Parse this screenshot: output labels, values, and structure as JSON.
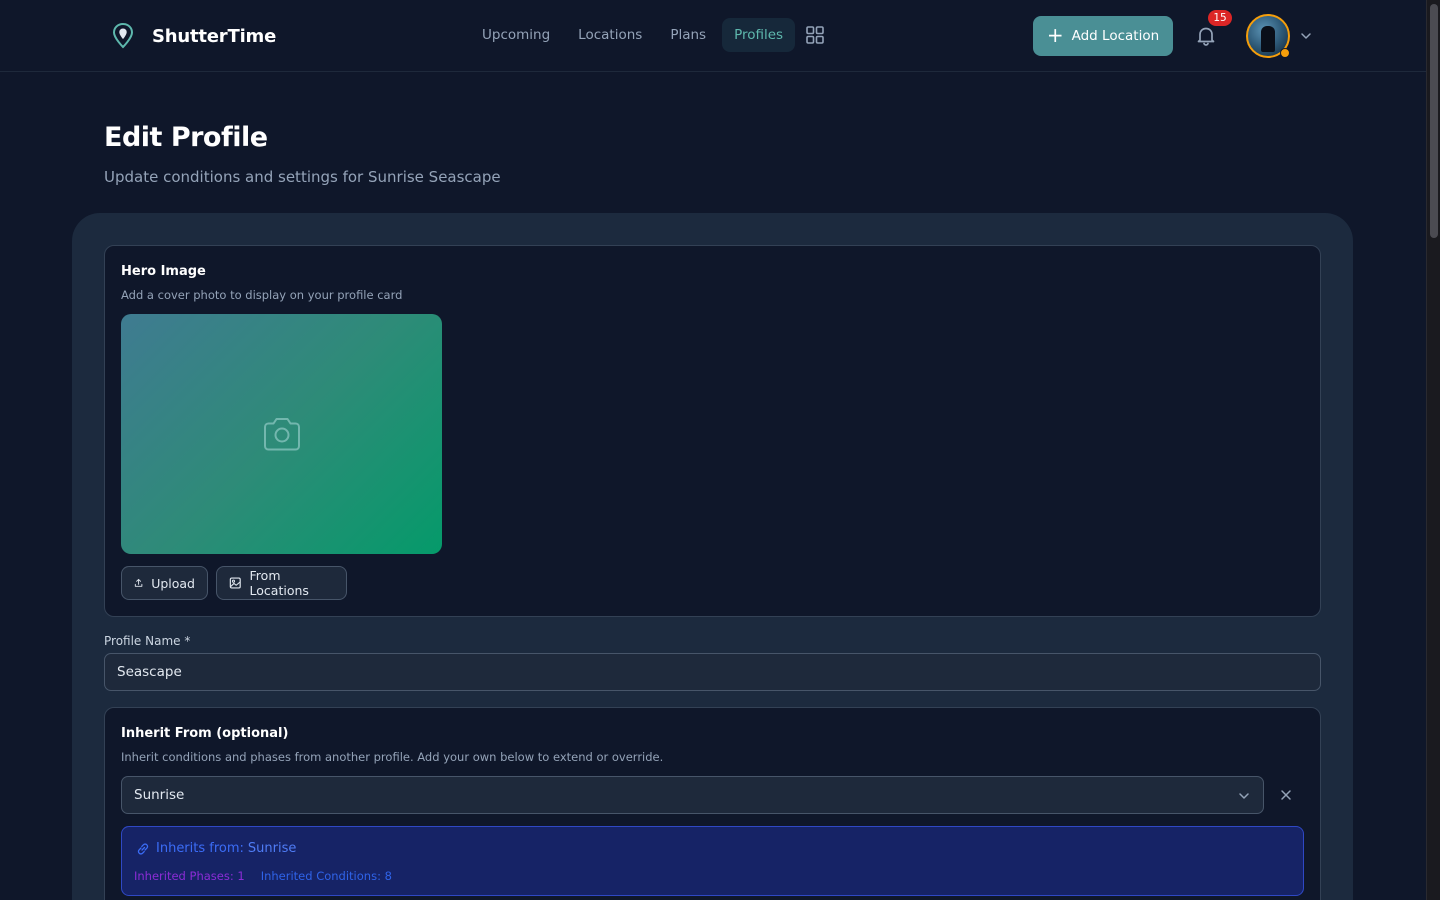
{
  "brand": {
    "name": "ShutterTime",
    "icon": "map-pin-icon"
  },
  "nav": {
    "items": [
      {
        "label": "Upcoming",
        "active": false
      },
      {
        "label": "Locations",
        "active": false
      },
      {
        "label": "Plans",
        "active": false
      },
      {
        "label": "Profiles",
        "active": true
      }
    ],
    "apps_icon": "grid-icon"
  },
  "header": {
    "add_location_label": "Add Location",
    "notification_count": "15"
  },
  "page": {
    "title": "Edit Profile",
    "subtitle": "Update conditions and settings for Sunrise Seascape"
  },
  "hero": {
    "title": "Hero Image",
    "description": "Add a cover photo to display on your profile card",
    "upload_label": "Upload",
    "from_locations_label": "From Locations"
  },
  "profile_name": {
    "label": "Profile Name *",
    "value": "Seascape"
  },
  "inherit": {
    "title": "Inherit From (optional)",
    "description": "Inherit conditions and phases from another profile. Add your own below to extend or override.",
    "selected": "Sunrise",
    "info_label": "Inherits from:",
    "info_value": "Sunrise",
    "phases_text": "Inherited Phases: 1",
    "conditions_text": "Inherited Conditions: 8"
  },
  "colors": {
    "background": "#0f172a",
    "card": "#1c2a3e",
    "accent": "#4a8f95",
    "active_nav": "#5eb8ad",
    "badge": "#dc2626",
    "avatar_ring": "#f59e0b"
  }
}
